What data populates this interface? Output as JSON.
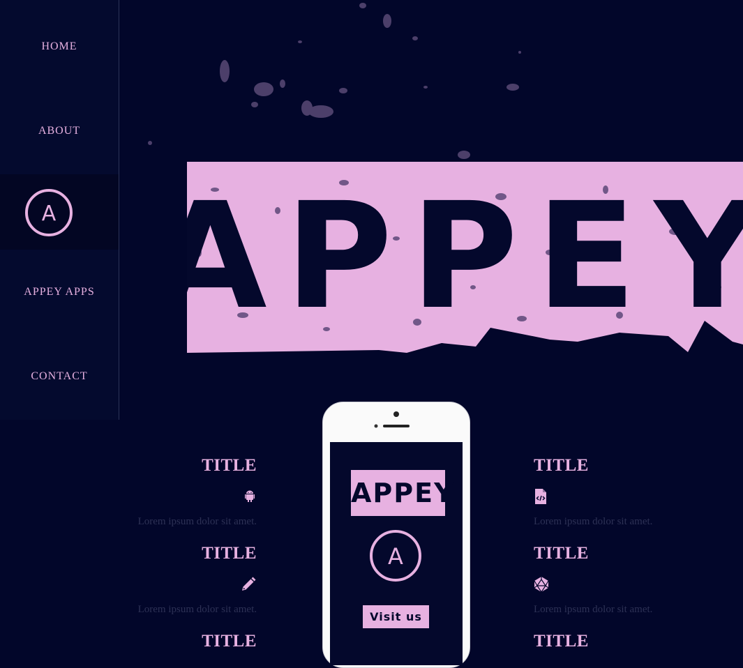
{
  "nav": {
    "items": [
      {
        "label": "HOME"
      },
      {
        "label": "ABOUT"
      },
      {
        "label": "APPEY APPS"
      },
      {
        "label": "CONTACT"
      }
    ],
    "logo_letter": "A"
  },
  "hero": {
    "brand": "APPEY"
  },
  "features": {
    "left": [
      {
        "title": "TITLE",
        "icon": "android-icon",
        "desc": "Lorem ipsum dolor sit amet."
      },
      {
        "title": "TITLE",
        "icon": "pencil-icon",
        "desc": "Lorem ipsum dolor sit amet."
      },
      {
        "title": "TITLE"
      }
    ],
    "right": [
      {
        "title": "TITLE",
        "icon": "code-file-icon",
        "desc": "Lorem ipsum dolor sit amet."
      },
      {
        "title": "TITLE",
        "icon": "dice-icon",
        "desc": "Lorem ipsum dolor sit amet."
      },
      {
        "title": "TITLE"
      }
    ]
  },
  "phone": {
    "brand": "APPEY",
    "logo_letter": "A",
    "button_label": "Visit us"
  },
  "colors": {
    "background": "#02062a",
    "sidebar": "#040a2e",
    "accent_pink": "#e7b1e1",
    "muted_text": "#2d3155"
  }
}
